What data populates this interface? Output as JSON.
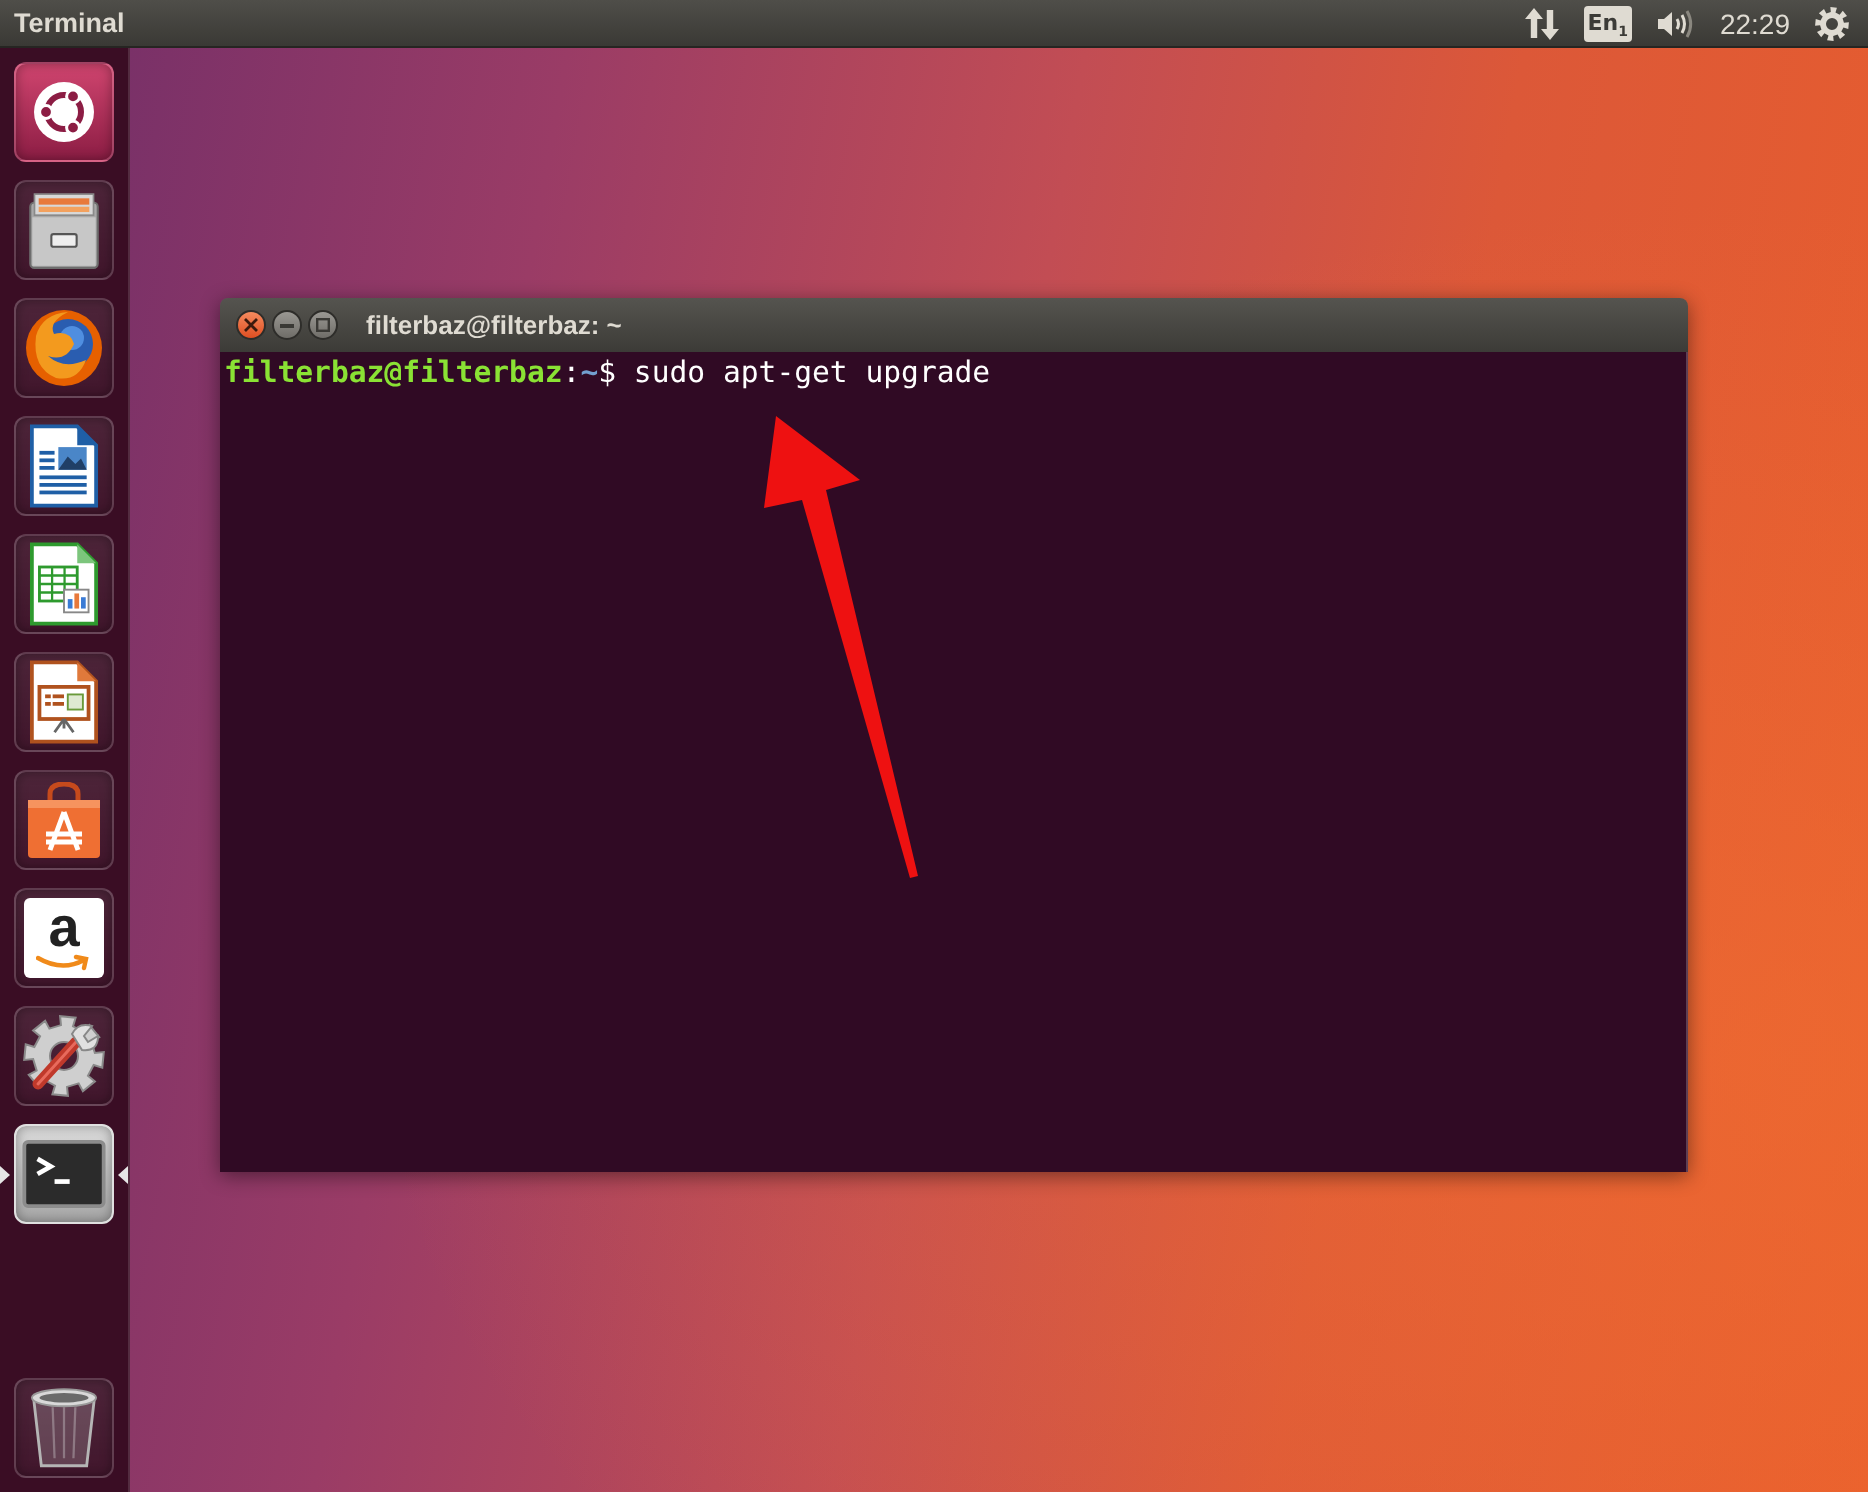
{
  "top_panel": {
    "app_title": "Terminal",
    "indicators": [
      {
        "kind": "network"
      },
      {
        "kind": "keyboard",
        "label": "En$_{1}$"
      },
      {
        "kind": "sound"
      },
      {
        "kind": "clock",
        "label": "22:29"
      },
      {
        "kind": "session"
      }
    ]
  },
  "launcher": {
    "items": [
      {
        "kind": "dash",
        "running": false,
        "selected": false
      },
      {
        "kind": "files",
        "running": false,
        "selected": false
      },
      {
        "kind": "browser",
        "running": false,
        "selected": false
      },
      {
        "kind": "writer",
        "running": false,
        "selected": false
      },
      {
        "kind": "calc",
        "running": false,
        "selected": false
      },
      {
        "kind": "impress",
        "running": false,
        "selected": false
      },
      {
        "kind": "software",
        "running": false,
        "selected": false
      },
      {
        "kind": "shop",
        "glyph": "a",
        "running": false,
        "selected": false
      },
      {
        "kind": "settings",
        "running": false,
        "selected": false
      },
      {
        "kind": "terminal",
        "running": true,
        "selected": true
      }
    ],
    "bottom_items": [
      {
        "kind": "trash",
        "running": false,
        "selected": false
      }
    ]
  },
  "window": {
    "title": "filterbaz@filterbaz: ~",
    "buttons": [
      {
        "kind": "close"
      },
      {
        "kind": "minimize"
      },
      {
        "kind": "maximize"
      }
    ],
    "lines": [
      {
        "segments": [
          {
            "kind": "user",
            "text": "filterbaz@filterbaz"
          },
          {
            "kind": "plain",
            "text": ":"
          },
          {
            "kind": "path",
            "text": "~"
          },
          {
            "kind": "plain",
            "text": "$ sudo apt-get upgrade"
          }
        ]
      }
    ]
  },
  "annotations": [
    {
      "kind": "arrow"
    }
  ]
}
